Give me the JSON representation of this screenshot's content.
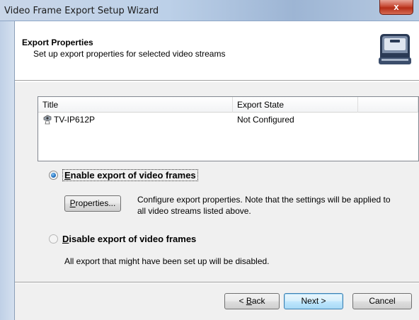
{
  "window": {
    "title": "Video Frame Export Setup Wizard",
    "close_label": "x"
  },
  "header": {
    "title": "Export Properties",
    "subtitle": "Set up export properties for selected video streams",
    "icon": "briefcase-icon"
  },
  "list": {
    "columns": [
      "Title",
      "Export State",
      ""
    ],
    "rows": [
      {
        "icon": "camera-icon",
        "title": "TV-IP612P",
        "state": "Not Configured"
      }
    ]
  },
  "options": {
    "enable": {
      "label_prefix": "",
      "label_access": "E",
      "label_rest": "nable export of video frames",
      "checked": true
    },
    "properties_button": {
      "access": "P",
      "rest": "roperties..."
    },
    "properties_desc_line1": "Configure export properties. Note that the settings will be applied to",
    "properties_desc_line2": "all video streams listed above.",
    "disable": {
      "label_access": "D",
      "label_rest": "isable export of video frames",
      "checked": false
    },
    "disable_desc": "All export that might have been set up will be disabled."
  },
  "footer": {
    "back_prefix": "< ",
    "back_access": "B",
    "back_rest": "ack",
    "next_label": "Next >",
    "cancel_label": "Cancel"
  }
}
